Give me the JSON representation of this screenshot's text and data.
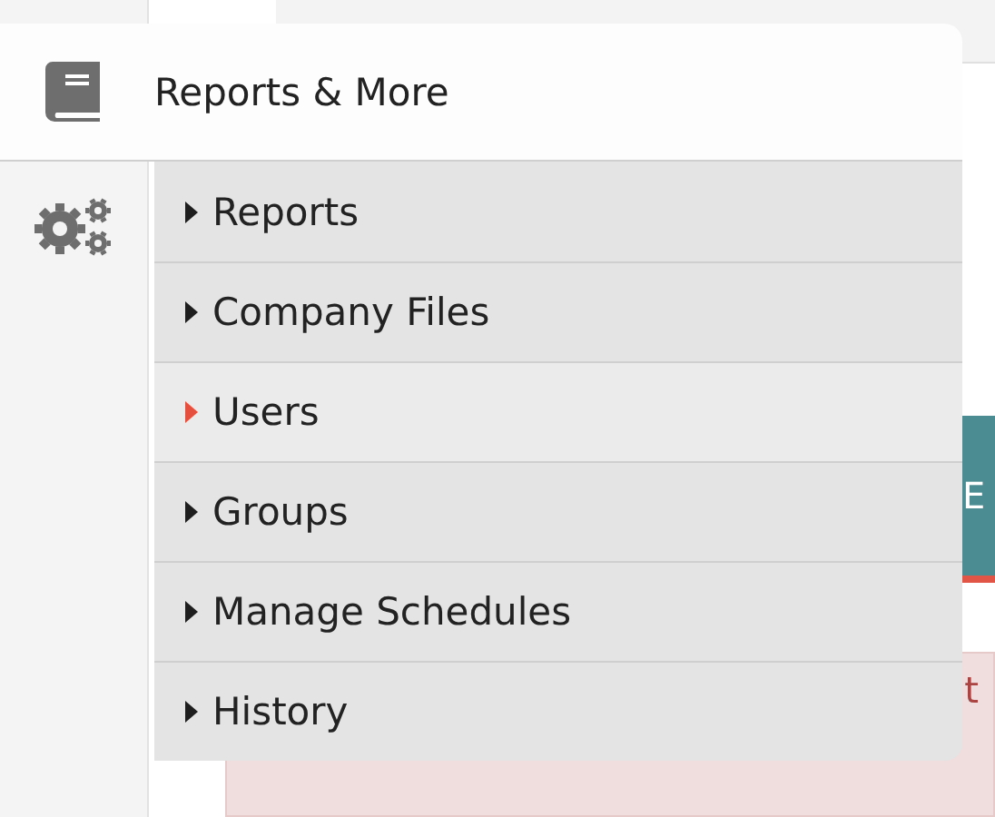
{
  "menu": {
    "title": "Reports & More",
    "items": [
      {
        "label": "Reports",
        "selected": false
      },
      {
        "label": "Company Files",
        "selected": false
      },
      {
        "label": "Users",
        "selected": true
      },
      {
        "label": "Groups",
        "selected": false
      },
      {
        "label": "Manage Schedules",
        "selected": false
      },
      {
        "label": "History",
        "selected": false
      }
    ]
  },
  "background": {
    "button_label": "E",
    "alert_text": "t"
  }
}
